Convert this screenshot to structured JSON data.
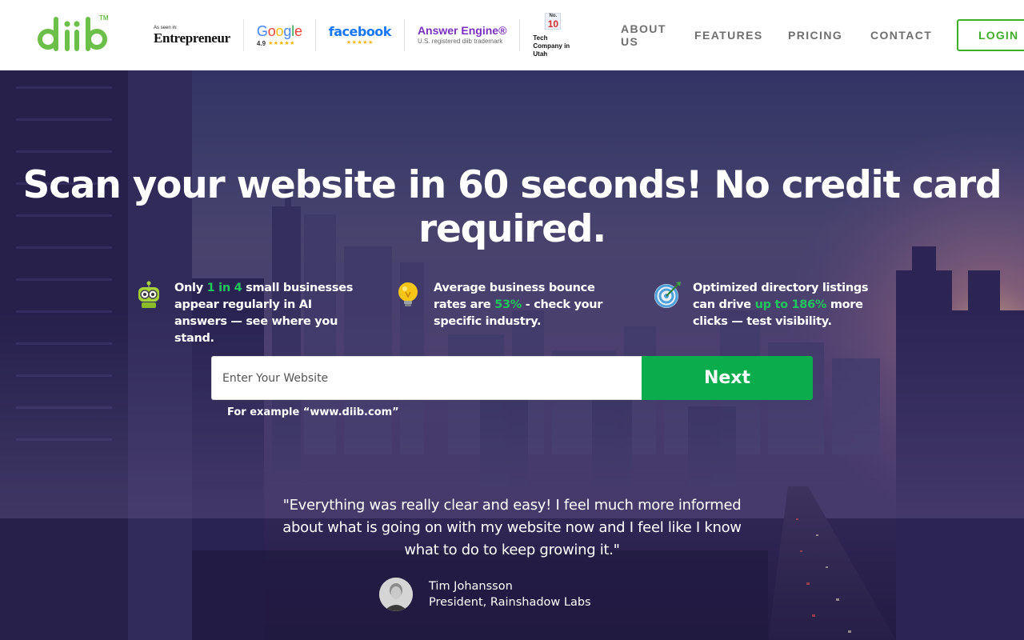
{
  "header": {
    "logo": {
      "text": "diib",
      "trademark": "TM"
    },
    "press": {
      "entrepreneur": {
        "small": "As seen in:",
        "name": "Entrepreneur"
      },
      "google": {
        "letters": [
          "G",
          "o",
          "o",
          "g",
          "l",
          "e"
        ],
        "rating": "4.9",
        "stars": "★★★★★"
      },
      "facebook": {
        "name": "facebook",
        "stars": "★★★★★"
      },
      "answer_engine": {
        "title": "Answer Engine®",
        "subtitle": "U.S. registered diib trademark"
      },
      "tech": {
        "badge_no": "No.",
        "badge_num": "10",
        "text": "Tech Company in Utah"
      }
    },
    "nav": {
      "about": "ABOUT US",
      "features": "FEATURES",
      "pricing": "PRICING",
      "contact": "CONTACT",
      "login": "LOGIN"
    }
  },
  "hero": {
    "headline": "Scan your website in 60 seconds! No credit card required.",
    "features": [
      {
        "icon": "robot-icon",
        "before": "Only ",
        "highlight": "1 in 4",
        "after": " small businesses appear regularly in AI answers — see where you stand."
      },
      {
        "icon": "lightbulb-icon",
        "before": "Average business bounce rates are ",
        "highlight": "53%",
        "after": " - check your specific industry."
      },
      {
        "icon": "target-icon",
        "before": "Optimized directory listings can drive ",
        "highlight": "up to 186%",
        "after": " more clicks — test visibility."
      }
    ],
    "form": {
      "placeholder": "Enter Your Website",
      "value": "",
      "button": "Next",
      "example": "For example “www.diib.com”"
    },
    "testimonial": {
      "quote": "\"Everything was really clear and easy! I feel much more informed about what is going on with my website now and I feel like I know what to do to keep growing it.\"",
      "name": "Tim Johansson",
      "title": "President, Rainshadow Labs"
    }
  },
  "colors": {
    "brand_green": "#6cc04a",
    "login_green": "#3fae29",
    "cta_green": "#0aac4b",
    "highlight_green": "#22c55e",
    "nav_gray": "#6f6f6f"
  }
}
